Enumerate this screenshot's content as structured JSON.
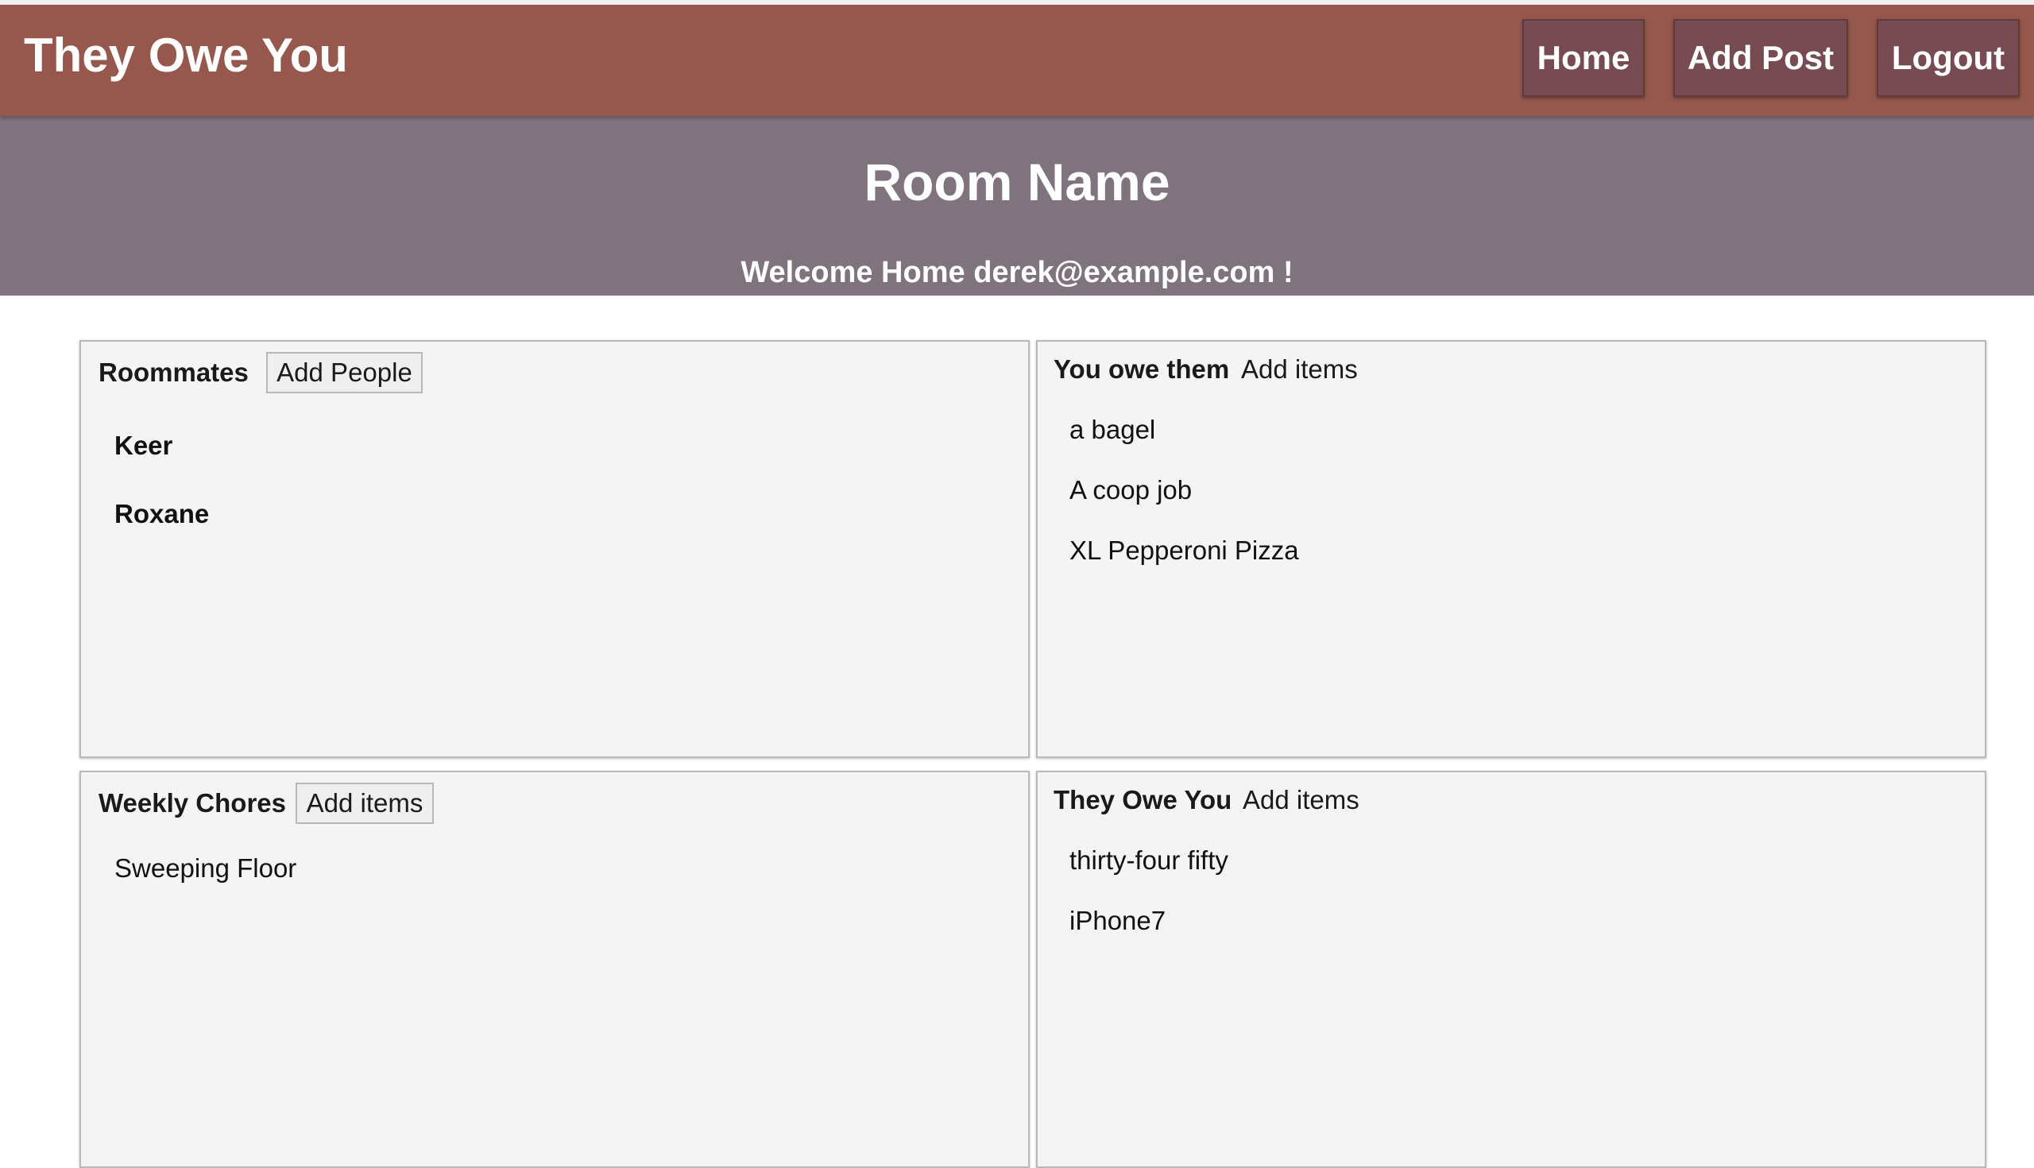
{
  "navbar": {
    "brand": "They Owe You",
    "links": [
      {
        "label": "Home"
      },
      {
        "label": "Add Post"
      },
      {
        "label": "Logout"
      }
    ],
    "color": "#96584c",
    "button_color": "#774b52"
  },
  "hero": {
    "title": "Room Name",
    "welcome": "Welcome Home derek@example.com !",
    "color": "#7f737e"
  },
  "panels": {
    "roommates": {
      "title": "Roommates",
      "button": "Add People",
      "items": [
        "Keer",
        "Roxane"
      ]
    },
    "you_owe_them": {
      "title": "You owe them",
      "button": "Add items",
      "items": [
        "a bagel",
        "A coop job",
        "XL Pepperoni Pizza"
      ]
    },
    "weekly_chores": {
      "title": "Weekly Chores",
      "button": "Add items",
      "items": [
        "Sweeping Floor"
      ]
    },
    "they_owe_you": {
      "title": "They Owe You",
      "button": "Add items",
      "items": [
        "thirty-four fifty",
        "iPhone7"
      ]
    }
  }
}
